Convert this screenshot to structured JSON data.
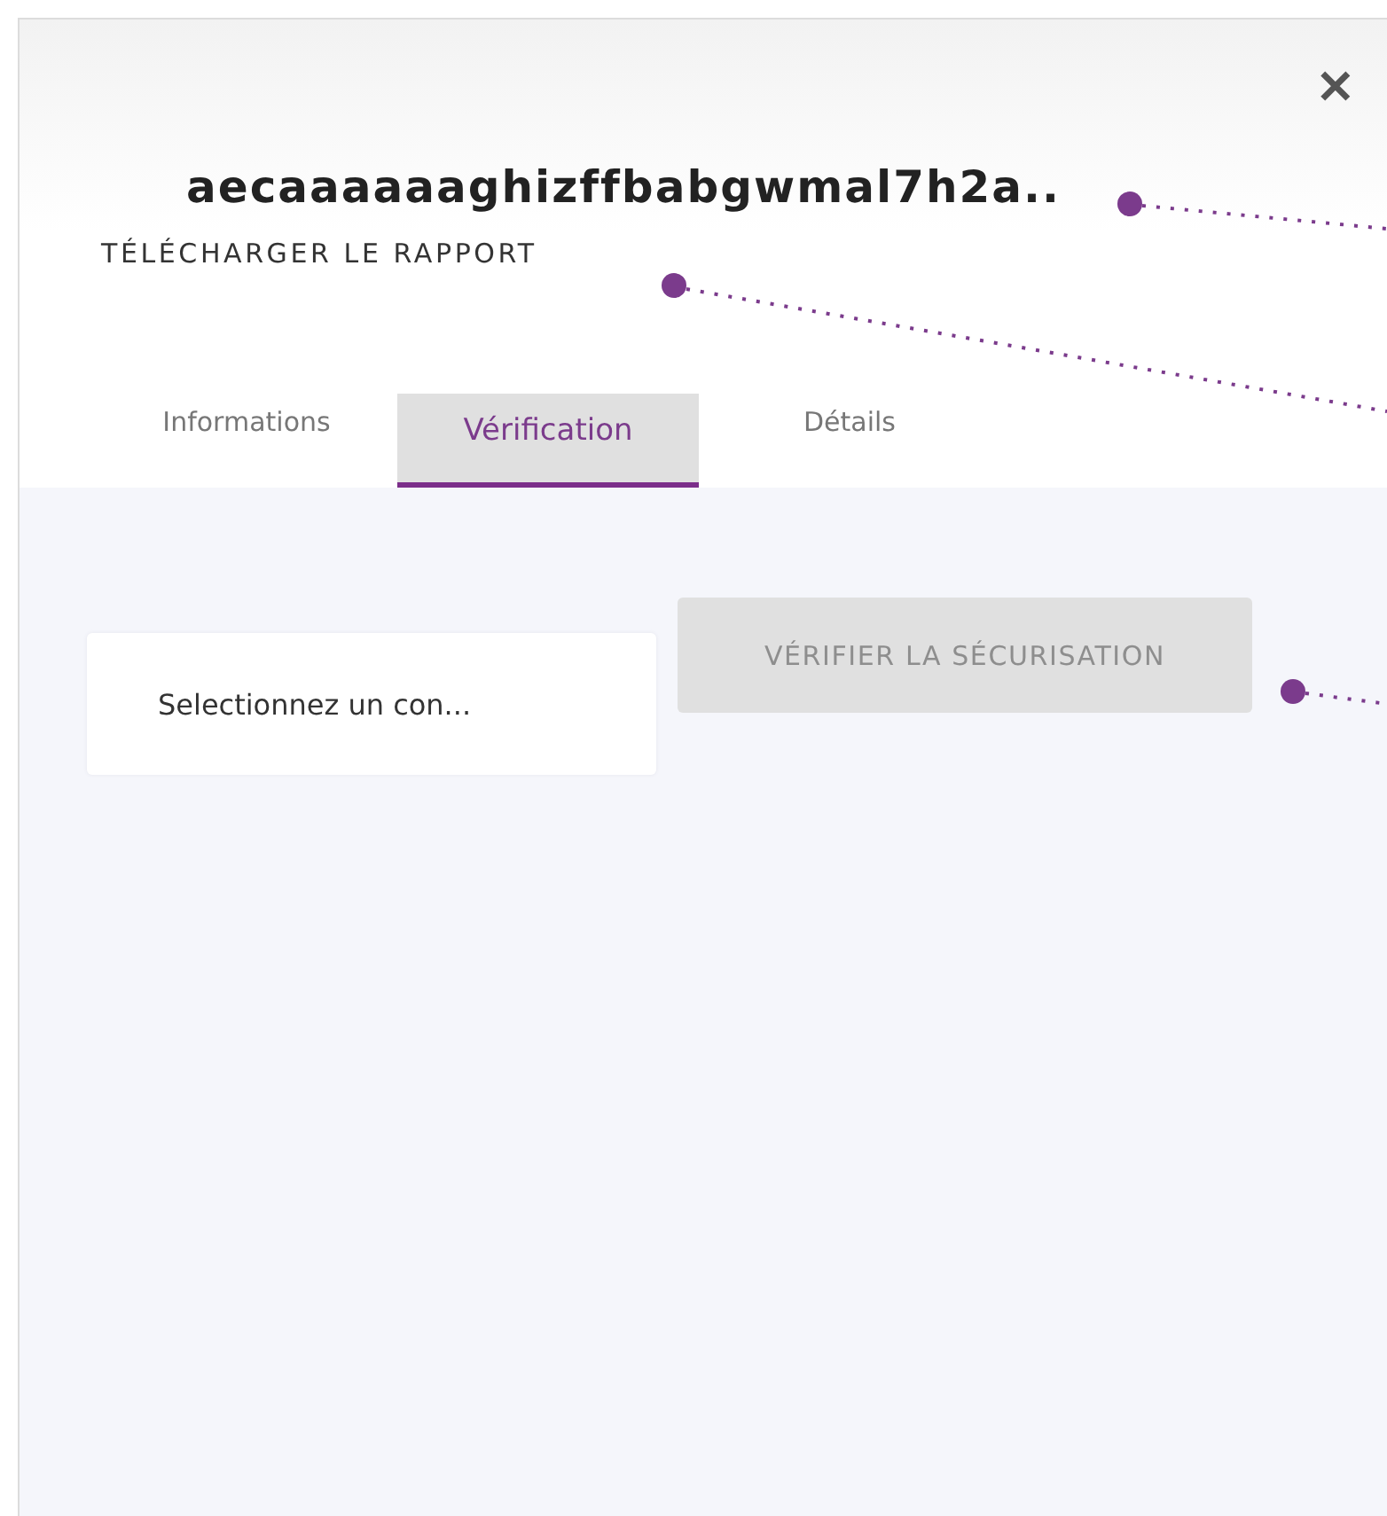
{
  "title": "aecaaaaaaghizffbabgwmal7h2a..",
  "download_link": "TÉLÉCHARGER LE RAPPORT",
  "close": "✕",
  "tabs": [
    {
      "label": "Informations",
      "selected": false
    },
    {
      "label": "Vérification",
      "selected": true
    },
    {
      "label": "Détails",
      "selected": false
    }
  ],
  "select": {
    "value": "Selectionnez un con..."
  },
  "verify_button": {
    "label": "VÉRIFIER LA SÉCURISATION",
    "disabled": true
  }
}
